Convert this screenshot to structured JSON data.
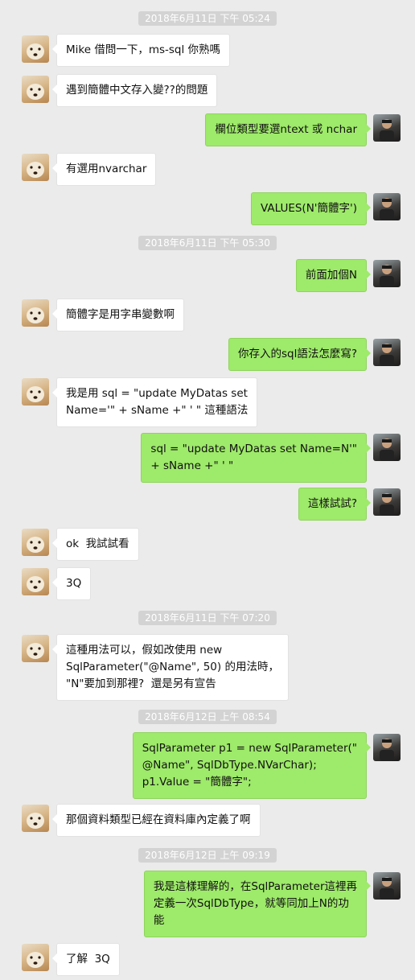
{
  "timestamps": [
    "2018年6月11日 下午 05:24",
    "2018年6月11日 下午 05:30",
    "2018年6月11日 下午 07:20",
    "2018年6月12日 上午 08:54",
    "2018年6月12日 上午 09:19"
  ],
  "messages": [
    {
      "side": "left",
      "text": "Mike 借問一下，ms-sql 你熟嗎"
    },
    {
      "side": "left",
      "text": "遇到簡體中文存入變??的問題"
    },
    {
      "side": "right",
      "text": "欄位類型要選ntext 或 nchar"
    },
    {
      "side": "left",
      "text": "有選用nvarchar"
    },
    {
      "side": "right",
      "text": "VALUES(N'簡體字')"
    },
    {
      "side": "right",
      "text": "前面加個N"
    },
    {
      "side": "left",
      "text": "簡體字是用字串變數啊"
    },
    {
      "side": "right",
      "text": "你存入的sql語法怎麼寫?"
    },
    {
      "side": "left",
      "text": "我是用 sql = \"update MyDatas set\nName='\" + sName +\" ' \" 這種語法"
    },
    {
      "side": "right",
      "text": "sql = \"update MyDatas set Name=N'\"\n+ sName +\" ' \""
    },
    {
      "side": "right",
      "text": "這樣試試?"
    },
    {
      "side": "left",
      "text": "ok  我試試看"
    },
    {
      "side": "left",
      "text": "3Q"
    },
    {
      "side": "left",
      "text": "這種用法可以，假如改使用 new\nSqlParameter(\"@Name\", 50) 的用法時，\n\"N\"要加到那裡?  還是另有宣告"
    },
    {
      "side": "right",
      "text": "SqlParameter p1 = new SqlParameter(\"\n@Name\", SqlDbType.NVarChar);\np1.Value = \"簡體字\";"
    },
    {
      "side": "left",
      "text": "那個資料類型已經在資料庫內定義了啊"
    },
    {
      "side": "right",
      "text": "我是這樣理解的，在SqlParameter這裡再\n定義一次SqlDbType，就等同加上N的功\n能"
    },
    {
      "side": "left",
      "text": "了解  3Q"
    }
  ],
  "colors": {
    "background": "#ebebeb",
    "incoming_bubble": "#ffffff",
    "outgoing_bubble": "#9eea6a",
    "timestamp_pill": "#d3d3d3"
  },
  "icons": {
    "left_avatar": "dog-avatar-icon",
    "right_avatar": "user-photo-avatar-icon"
  }
}
